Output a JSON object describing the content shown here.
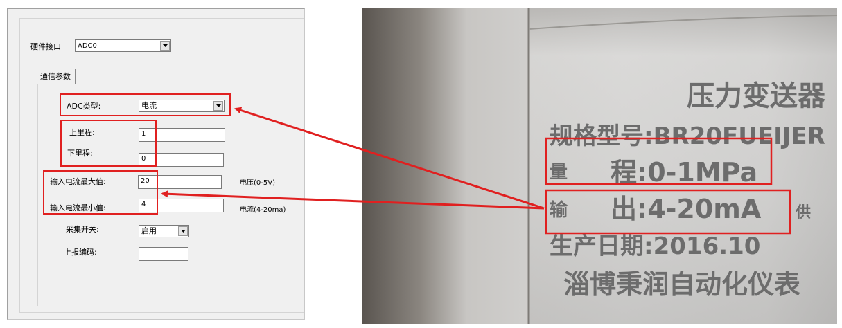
{
  "dialog": {
    "hw_interface": {
      "label": "硬件接口",
      "value": "ADC0"
    },
    "tab_label": "通信参数",
    "adc_type": {
      "label": "ADC类型:",
      "value": "电流"
    },
    "upper_range": {
      "label": "上里程:",
      "value": "1"
    },
    "lower_range": {
      "label": "下里程:",
      "value": "0"
    },
    "max_input": {
      "label": "输入电流最大值:",
      "value": "20",
      "note": "电压(0-5V)"
    },
    "min_input": {
      "label": "输入电流最小值:",
      "value": "4",
      "note": "电流(4-20ma)"
    },
    "collect_switch": {
      "label": "采集开关:",
      "value": "启用"
    },
    "report_code": {
      "label": "上报编码:",
      "value": ""
    }
  },
  "photo": {
    "title": "压力变送器",
    "model": "规格型号:BR20FUEIJER",
    "range": "程:0-1MPa",
    "output": "出:4-20mA",
    "supply": "供",
    "date": "生产日期:2016.10",
    "maker": "淄博秉润自动化仪表",
    "side_left": "量",
    "side_left2": "输"
  },
  "colors": {
    "annotation": "#e02020",
    "dialog_bg": "#f0f0f0"
  }
}
